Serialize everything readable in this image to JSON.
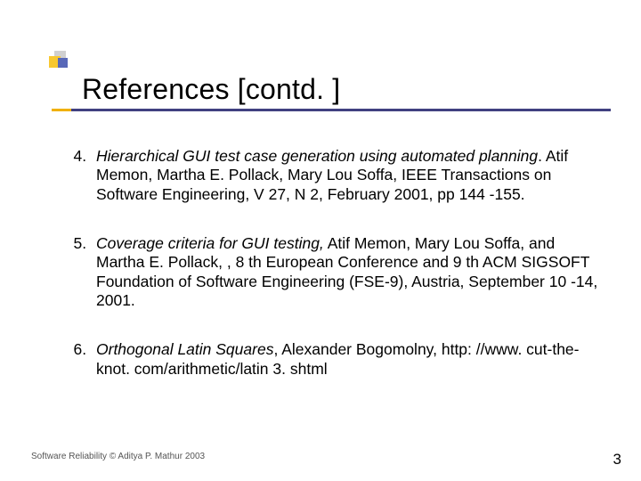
{
  "slide": {
    "title": "References [contd. ]",
    "list_start": 4,
    "refs": [
      {
        "title": "Hierarchical GUI test case generation using automated planning",
        "rest": ". Atif Memon, Martha E. Pollack, Mary Lou Soffa, IEEE Transactions on Software Engineering, V 27, N 2, February 2001, pp 144 -155."
      },
      {
        "title": "Coverage criteria for GUI testing,",
        "rest": " Atif Memon, Mary Lou Soffa, and Martha E. Pollack, , 8 th European Conference and 9 th ACM SIGSOFT Foundation of Software Engineering (FSE-9), Austria, September 10 -14, 2001."
      },
      {
        "title": "Orthogonal Latin Squares",
        "rest": ", Alexander Bogomolny, http: //www. cut-the-knot. com/arithmetic/latin 3. shtml"
      }
    ],
    "footer": "Software Reliability © Aditya P. Mathur 2003",
    "page_number": "3"
  }
}
